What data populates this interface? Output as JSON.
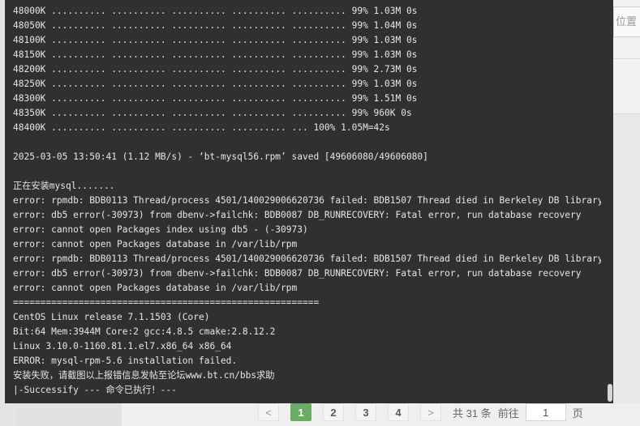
{
  "terminal": {
    "lines": [
      "48000K .......... .......... .......... .......... .......... 99% 1.03M 0s",
      "48050K .......... .......... .......... .......... .......... 99% 1.04M 0s",
      "48100K .......... .......... .......... .......... .......... 99% 1.03M 0s",
      "48150K .......... .......... .......... .......... .......... 99% 1.03M 0s",
      "48200K .......... .......... .......... .......... .......... 99% 2.73M 0s",
      "48250K .......... .......... .......... .......... .......... 99% 1.03M 0s",
      "48300K .......... .......... .......... .......... .......... 99% 1.51M 0s",
      "48350K .......... .......... .......... .......... .......... 99% 960K 0s",
      "48400K .......... .......... .......... .......... ... 100% 1.05M=42s",
      "",
      "2025-03-05 13:50:41 (1.12 MB/s) - ‘bt-mysql56.rpm’ saved [49606080/49606080]",
      "",
      "正在安装mysql.......",
      "error: rpmdb: BDB0113 Thread/process 4501/140029006620736 failed: BDB1507 Thread died in Berkeley DB library",
      "error: db5 error(-30973) from dbenv->failchk: BDB0087 DB_RUNRECOVERY: Fatal error, run database recovery",
      "error: cannot open Packages index using db5 - (-30973)",
      "error: cannot open Packages database in /var/lib/rpm",
      "error: rpmdb: BDB0113 Thread/process 4501/140029006620736 failed: BDB1507 Thread died in Berkeley DB library",
      "error: db5 error(-30973) from dbenv->failchk: BDB0087 DB_RUNRECOVERY: Fatal error, run database recovery",
      "error: cannot open Packages database in /var/lib/rpm",
      "========================================================",
      "CentOS Linux release 7.1.1503 (Core)",
      "Bit:64 Mem:3944M Core:2 gcc:4.8.5 cmake:2.8.12.2",
      "Linux 3.10.0-1160.81.1.el7.x86_64 x86_64",
      "ERROR: mysql-rpm-5.6 installation failed.",
      "安装失败，请截图以上报错信息发帖至论坛www.bt.cn/bbs求助",
      "|-Successify --- 命令已执行！---"
    ]
  },
  "background": {
    "right_button_label": "位置"
  },
  "pagination": {
    "prev": "<",
    "pages": [
      "1",
      "2",
      "3",
      "4"
    ],
    "active_page": "1",
    "next": ">",
    "total": "共 31 条",
    "goto_label": "前往",
    "goto_value": "1",
    "page_suffix": "页"
  }
}
